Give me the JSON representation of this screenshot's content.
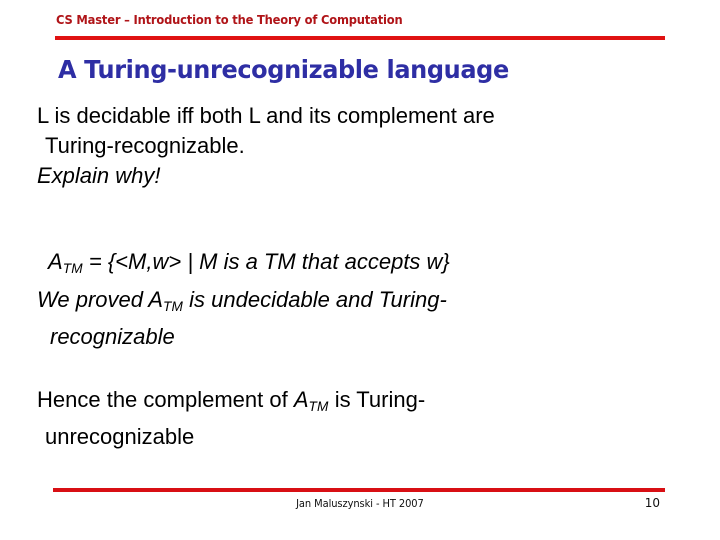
{
  "slide": {
    "header": "CS Master – Introduction to the Theory of Computation",
    "title": "A Turing-unrecognizable language",
    "colors": {
      "header_text": "#b01418",
      "rule": "#e01212",
      "title": "#2e2ea4",
      "body_text": "#000000",
      "background": "#ffffff"
    },
    "body": {
      "para_decidable": {
        "line1": "L is decidable iff both  L and its complement  are",
        "line2": "Turing-recognizable.",
        "line3": "Explain why!"
      },
      "para_atm": {
        "a_symbol": "A",
        "a_subscript": "TM",
        "definition": " = {<M,w> | M is a TM that accepts w}"
      },
      "para_proved": {
        "before": "We proved ",
        "a_symbol": "A",
        "a_subscript": "TM",
        "after": " is  undecidable and Turing-",
        "line2": "recognizable"
      },
      "para_hence": {
        "before": "Hence  the complement of ",
        "a_symbol": "A",
        "a_subscript": "TM",
        "after": "  is  Turing-",
        "line2": "unrecognizable"
      }
    },
    "footer": {
      "author_date": "Jan Maluszynski - HT 2007",
      "page_number": "10"
    }
  }
}
